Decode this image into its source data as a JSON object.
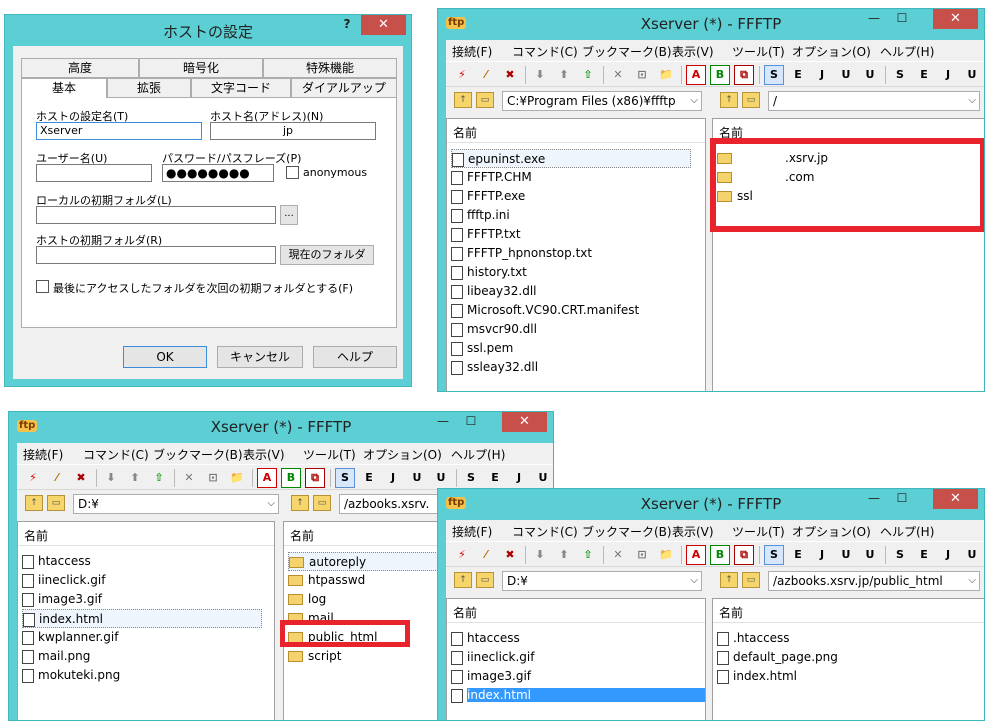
{
  "dialog": {
    "title": "ホストの設定",
    "help_glyph": "?",
    "close_glyph": "✕",
    "tabs_row1": [
      "高度",
      "暗号化",
      "特殊機能"
    ],
    "tabs_row2": [
      "基本",
      "拡張",
      "文字コード",
      "ダイアルアップ"
    ],
    "host_setting_name_label": "ホストの設定名(T)",
    "host_setting_name_value": "Xserver",
    "host_name_label": "ホスト名(アドレス)(N)",
    "host_name_value": "jp",
    "user_name_label": "ユーザー名(U)",
    "user_name_value": "",
    "password_label": "パスワード/パスフレーズ(P)",
    "password_value": "●●●●●●●●",
    "anonymous_label": "anonymous",
    "local_folder_label": "ローカルの初期フォルダ(L)",
    "local_folder_value": "",
    "browse_label": "...",
    "host_folder_label": "ホストの初期フォルダ(R)",
    "host_folder_value": "",
    "current_folder_label": "現在のフォルダ",
    "last_folder_label": "最後にアクセスしたフォルダを次回の初期フォルダとする(F)",
    "ok_label": "OK",
    "cancel_label": "キャンセル",
    "help_label": "ヘルプ"
  },
  "ffftp": {
    "title": "Xserver (*) - FFFTP",
    "app_icon_text": "ftp",
    "minimize_glyph": "—",
    "maximize_glyph": "☐",
    "close_glyph": "✕",
    "menu": [
      "接続(F)",
      "コマンド(C)",
      "ブックマーク(B)",
      "表示(V)",
      "ツール(T)",
      "オプション(O)",
      "ヘルプ(H)"
    ],
    "toolbar": [
      "⚡",
      "⁄",
      "✖",
      "⬇",
      "⬆",
      "⇧",
      "✕",
      "⊡",
      "📁",
      "A",
      "B",
      "⧉",
      "S",
      "E",
      "J",
      "U",
      "U",
      "S",
      "E",
      "J",
      "U"
    ],
    "name_header": "名前"
  },
  "win1": {
    "local_path": "C:¥Program Files (x86)¥ffftp",
    "remote_path": "/",
    "local_files": [
      "epuninst.exe",
      "FFFTP.CHM",
      "FFFTP.exe",
      "ffftp.ini",
      "FFFTP.txt",
      "FFFTP_hpnonstop.txt",
      "history.txt",
      "libeay32.dll",
      "Microsoft.VC90.CRT.manifest",
      "msvcr90.dll",
      "ssl.pem",
      "ssleay32.dll"
    ],
    "remote_folders": [
      ".xsrv.jp",
      ".com",
      "ssl"
    ]
  },
  "win2": {
    "local_path": "D:¥",
    "remote_path": "/azbooks.xsrv.",
    "local_files": [
      "htaccess",
      "iineclick.gif",
      "image3.gif",
      "index.html",
      "kwplanner.gif",
      "mail.png",
      "mokuteki.png"
    ],
    "remote_folders": [
      "autoreply",
      "htpasswd",
      "log",
      "mail",
      "public_html",
      "script"
    ]
  },
  "win3": {
    "local_path": "D:¥",
    "remote_path": "/azbooks.xsrv.jp/public_html",
    "local_files": [
      "htaccess",
      "iineclick.gif",
      "image3.gif",
      "index.html"
    ],
    "remote_files": [
      ".htaccess",
      "default_page.png",
      "index.html"
    ]
  },
  "colors": {
    "frame": "#5bcfd4",
    "close": "#c7504b",
    "highlight": "#e8232b",
    "selection": "#3399ff"
  }
}
